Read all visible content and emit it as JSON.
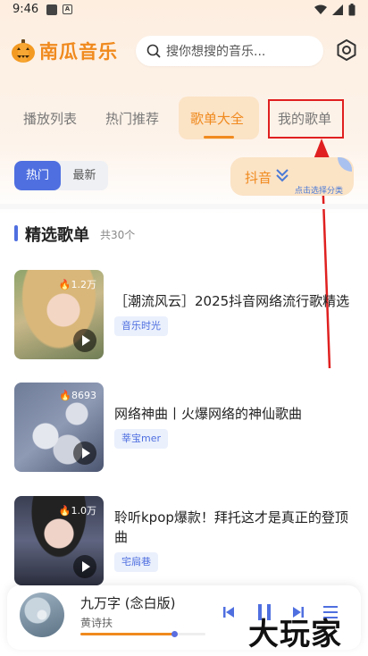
{
  "status_bar": {
    "time": "9:46",
    "notif_icon_letter": "A"
  },
  "header": {
    "app_name": "南瓜音乐",
    "search_placeholder": "搜你想搜的音乐..."
  },
  "tabs": [
    {
      "label": "播放列表",
      "active": false
    },
    {
      "label": "热门推荐",
      "active": false
    },
    {
      "label": "歌单大全",
      "active": true
    },
    {
      "label": "我的歌单",
      "active": false,
      "highlighted": true
    }
  ],
  "filter": {
    "segments": [
      {
        "label": "热门",
        "active": true
      },
      {
        "label": "最新",
        "active": false
      }
    ],
    "category_button": {
      "label": "抖音",
      "hint": "点击选择分类"
    }
  },
  "section": {
    "title": "精选歌单",
    "count": "共30个"
  },
  "playlists": [
    {
      "title": "［潮流风云］2025抖音网络流行歌精选",
      "play_count": "1.2万",
      "tag": "音乐时光"
    },
    {
      "title": "网络神曲丨火爆网络的神仙歌曲",
      "play_count": "8693",
      "tag": "莘宝mer"
    },
    {
      "title": "聆听kpop爆款！拜托这才是真正的登顶曲",
      "play_count": "1.0万",
      "tag": "宅扃巷"
    }
  ],
  "player": {
    "song": "九万字 (念白版)",
    "artist": "黄诗扶",
    "progress": 0.75
  },
  "watermark": "大玩家",
  "colors": {
    "accent": "#f08a1e",
    "blue": "#4f6fe0",
    "highlight_box": "#e02020"
  }
}
